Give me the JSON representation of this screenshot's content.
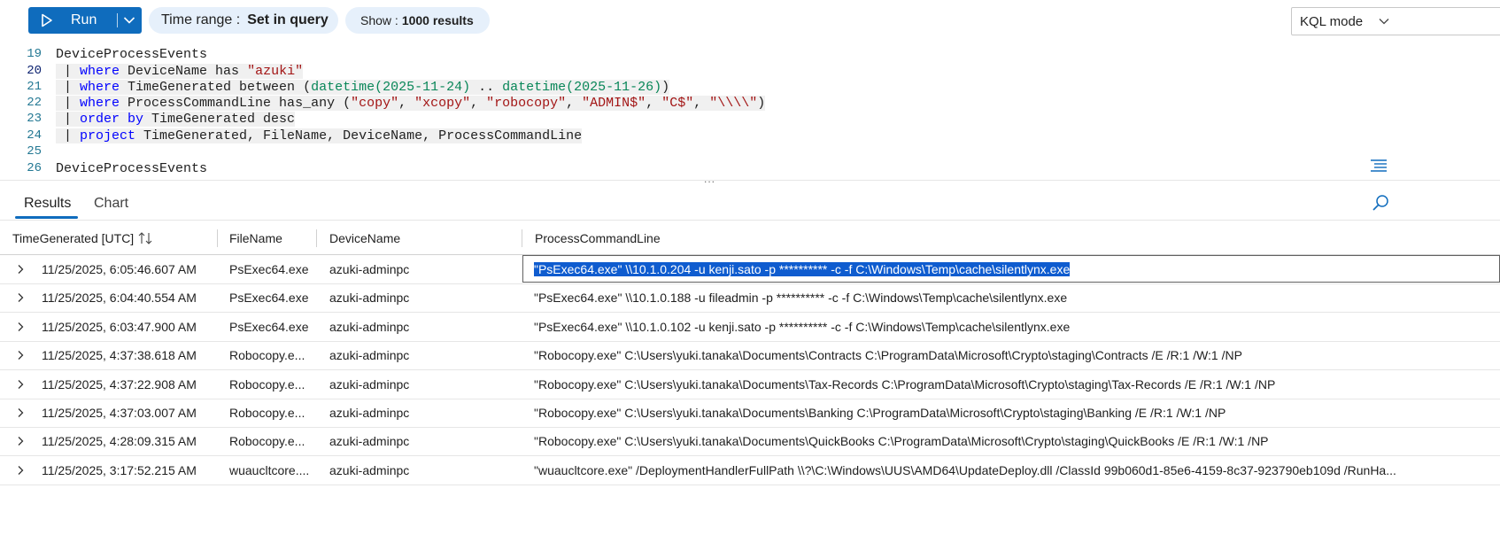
{
  "toolbar": {
    "run_label": "Run",
    "time_range_key": "Time range :",
    "time_range_value": "Set in query",
    "show_key": "Show :",
    "show_value": "1000 results",
    "mode_value": "KQL mode"
  },
  "editor": {
    "line_numbers": [
      "19",
      "20",
      "21",
      "22",
      "23",
      "24",
      "25",
      "26"
    ],
    "line_19": "DeviceProcessEvents",
    "line_20_a": " | ",
    "line_20_kw": "where",
    "line_20_b": " DeviceName has ",
    "line_20_s": "\"azuki\"",
    "line_21_a": " | ",
    "line_21_kw": "where",
    "line_21_b": " TimeGenerated between (",
    "line_21_f1": "datetime(2025-11-24)",
    "line_21_c": " .. ",
    "line_21_f2": "datetime(2025-11-26)",
    "line_21_d": ")",
    "line_22_a": " | ",
    "line_22_kw": "where",
    "line_22_b": " ProcessCommandLine has_any (",
    "line_22_s1": "\"copy\"",
    "line_22_s2": "\"xcopy\"",
    "line_22_s3": "\"robocopy\"",
    "line_22_s4": "\"ADMIN$\"",
    "line_22_s5": "\"C$\"",
    "line_22_s6": "\"\\\\\\\\\"",
    "line_22_comma": ", ",
    "line_22_end": ")",
    "line_23_a": " | ",
    "line_23_kw": "order by",
    "line_23_b": " TimeGenerated desc",
    "line_24_a": " | ",
    "line_24_kw": "project",
    "line_24_b": " TimeGenerated, FileName, DeviceName, ProcessCommandLine",
    "line_26": "DeviceProcessEvents",
    "splitter": "..."
  },
  "tabs": {
    "results": "Results",
    "chart": "Chart"
  },
  "grid": {
    "columns": [
      "TimeGenerated [UTC]",
      "FileName",
      "DeviceName",
      "ProcessCommandLine"
    ],
    "rows": [
      {
        "time": "11/25/2025, 6:05:46.607 AM",
        "file": "PsExec64.exe",
        "device": "azuki-adminpc",
        "cmd": "\"PsExec64.exe\" \\\\10.1.0.204 -u kenji.sato -p ********** -c -f C:\\Windows\\Temp\\cache\\silentlynx.exe"
      },
      {
        "time": "11/25/2025, 6:04:40.554 AM",
        "file": "PsExec64.exe",
        "device": "azuki-adminpc",
        "cmd": "\"PsExec64.exe\" \\\\10.1.0.188 -u fileadmin -p ********** -c -f C:\\Windows\\Temp\\cache\\silentlynx.exe"
      },
      {
        "time": "11/25/2025, 6:03:47.900 AM",
        "file": "PsExec64.exe",
        "device": "azuki-adminpc",
        "cmd": "\"PsExec64.exe\" \\\\10.1.0.102 -u kenji.sato -p ********** -c -f C:\\Windows\\Temp\\cache\\silentlynx.exe"
      },
      {
        "time": "11/25/2025, 4:37:38.618 AM",
        "file": "Robocopy.e...",
        "device": "azuki-adminpc",
        "cmd": "\"Robocopy.exe\" C:\\Users\\yuki.tanaka\\Documents\\Contracts C:\\ProgramData\\Microsoft\\Crypto\\staging\\Contracts /E /R:1 /W:1 /NP"
      },
      {
        "time": "11/25/2025, 4:37:22.908 AM",
        "file": "Robocopy.e...",
        "device": "azuki-adminpc",
        "cmd": "\"Robocopy.exe\" C:\\Users\\yuki.tanaka\\Documents\\Tax-Records C:\\ProgramData\\Microsoft\\Crypto\\staging\\Tax-Records /E /R:1 /W:1 /NP"
      },
      {
        "time": "11/25/2025, 4:37:03.007 AM",
        "file": "Robocopy.e...",
        "device": "azuki-adminpc",
        "cmd": "\"Robocopy.exe\" C:\\Users\\yuki.tanaka\\Documents\\Banking C:\\ProgramData\\Microsoft\\Crypto\\staging\\Banking /E /R:1 /W:1 /NP"
      },
      {
        "time": "11/25/2025, 4:28:09.315 AM",
        "file": "Robocopy.e...",
        "device": "azuki-adminpc",
        "cmd": "\"Robocopy.exe\" C:\\Users\\yuki.tanaka\\Documents\\QuickBooks C:\\ProgramData\\Microsoft\\Crypto\\staging\\QuickBooks /E /R:1 /W:1 /NP"
      },
      {
        "time": "11/25/2025, 3:17:52.215 AM",
        "file": "wuaucltcore....",
        "device": "azuki-adminpc",
        "cmd": "\"wuaucltcore.exe\" /DeploymentHandlerFullPath \\\\?\\C:\\Windows\\UUS\\AMD64\\UpdateDeploy.dll /ClassId 99b060d1-85e6-4159-8c37-923790eb109d /RunHa..."
      }
    ]
  },
  "colors": {
    "accent": "#0f6cbd",
    "pill": "#e6f0fb",
    "keyword": "#0000ff",
    "string": "#a31515",
    "function": "#098658",
    "line_number": "#237893"
  }
}
